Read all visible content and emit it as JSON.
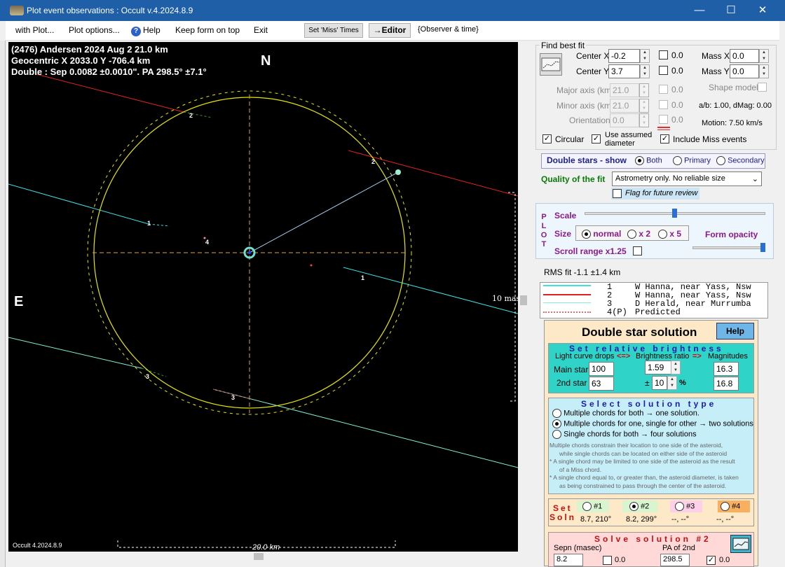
{
  "window": {
    "title": "Plot event observations : Occult v.4.2024.8.9",
    "minimize": "—",
    "maximize": "☐",
    "close": "✕"
  },
  "menu": {
    "with_plot": "with Plot...",
    "plot_options": "Plot options...",
    "help": "Help",
    "help_icon": "?",
    "keep_on_top": "Keep form on top",
    "exit": "Exit",
    "set_miss_times": "Set 'Miss' Times",
    "editor": "→Editor",
    "observer_time": "{Observer & time}"
  },
  "plot": {
    "line1": "(2476) Andersen  2024 Aug 2   21.0 km",
    "line2": "Geocentric  X  2033.0  Y -706.4 km",
    "line3": "Double : Sep  0.0082 ±0.0010\".  PA 298.5° ±7.1°",
    "north": "N",
    "east": "E",
    "scale_mas": "10 mas",
    "scale_km": "20.0 km",
    "version": "Occult 4.2024.8.9",
    "chord_labels": {
      "c1a": "1",
      "c1b": "1",
      "c2a": "2",
      "c2b": "2",
      "c3a": "3",
      "c3b": "3",
      "c4": "4"
    },
    "colors": {
      "chord1": "#40e0e0",
      "chord2": "#e02020",
      "chord3": "#80f0d0",
      "outline": "#e6e600",
      "axes": "#e0a050"
    }
  },
  "find_best_fit": {
    "title": "Find best fit",
    "center_x_label": "Center X",
    "center_x": "-0.2",
    "center_y_label": "Center Y",
    "center_y": "3.7",
    "cb_x": "0.0",
    "cb_y": "0.0",
    "mass_x_label": "Mass X",
    "mass_x": "0.0",
    "mass_y_label": "Mass Y",
    "mass_y": "0.0",
    "major_label": "Major axis (km)",
    "major": "21.0",
    "major_cb": "0.0",
    "minor_label": "Minor axis (km)",
    "minor": "21.0",
    "minor_cb": "0.0",
    "orient_label": "Orientation",
    "orient": "0.0",
    "orient_cb": "0.0",
    "shape_model": "Shape model",
    "ab_text": "a/b: 1.00, dMag: 0.00",
    "motion": "Motion: 7.50 km/s",
    "circular": "Circular",
    "use_assumed": "Use assumed",
    "diameter": "diameter",
    "include_miss": "Include Miss events"
  },
  "double_show": {
    "label": "Double stars - show",
    "both": "Both",
    "primary": "Primary",
    "secondary": "Secondary"
  },
  "quality": {
    "label": "Quality of the fit",
    "value": "Astrometry only. No reliable size",
    "flag": "Flag for future review"
  },
  "plot_panel": {
    "side": [
      "P",
      "L",
      "O",
      "T"
    ],
    "scale": "Scale",
    "size": "Size",
    "normal": "normal",
    "x2": "x 2",
    "x5": "x 5",
    "form_opacity": "Form opacity",
    "scroll_range": "Scroll range x1.25"
  },
  "rms": "RMS fit -1.1 ±1.4 km",
  "legend": [
    {
      "num": "1",
      "text": "W Hanna, near Yass, Nsw",
      "color": "#40e0e0"
    },
    {
      "num": "2",
      "text": "W Hanna, near Yass, Nsw",
      "color": "#e02020"
    },
    {
      "num": "3",
      "text": "D Herald, near Murrumba",
      "color": "#80f0d0"
    },
    {
      "num": "4(P)",
      "text": "Predicted",
      "color": "#e07070"
    }
  ],
  "dsol": {
    "title": "Double star solution",
    "help": "Help",
    "rel": {
      "title": "Set relative brightness",
      "lc": "Light curve drops",
      "arr1": "<=>",
      "br": "Brightness ratio",
      "arr2": "=>",
      "mag": "Magnitudes",
      "main": "Main star",
      "main_v": "100",
      "ratio": "1.59",
      "mag1": "16.3",
      "second": "2nd star",
      "second_v": "63",
      "pm": "±",
      "pct_v": "10",
      "pct": "%",
      "mag2": "16.8"
    },
    "type": {
      "title": "Select solution type",
      "o1": "Multiple chords for both → one solution.",
      "o2": "Multiple chords for one, single for other → two solutions",
      "o3": "Single chords for both → four solutions",
      "n1": "Multiple chords constrain their location to one side of the asteroid,",
      "n1b": "while single chords can be located on either side of the asteroid",
      "n2": "* A single chord may be limited to one side of the asteroid as the result",
      "n2b": "of a Miss chord.",
      "n3": "* A single chord equal to, or greater than, the asteroid diameter, is taken",
      "n3b": "as being constrained to pass through the center of the asteroid."
    },
    "soln": {
      "set": "Set",
      "soln": "Soln",
      "s1": "#1",
      "s2": "#2",
      "s3": "#3",
      "s4": "#4",
      "v1": "8.7, 210°",
      "v2": "8.2, 299°",
      "v3": "--, --°",
      "v4": "--, --°"
    },
    "solve": {
      "title": "Solve solution #2",
      "sepn": "Sepn (masec)",
      "pa": "PA of 2nd",
      "sep_v": "8.2",
      "pa_v": "298.5",
      "cb1": "0.0",
      "cb2": "0.0"
    }
  }
}
